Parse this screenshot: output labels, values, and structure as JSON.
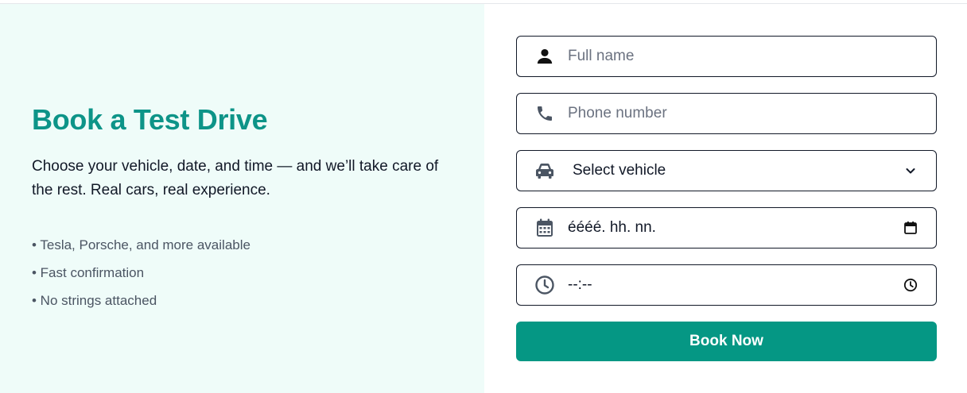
{
  "hero": {
    "title": "Book a Test Drive",
    "description": "Choose your vehicle, date, and time — and we’ll take care of the rest. Real cars, real experience.",
    "bullets": [
      "• Tesla, Porsche, and more available",
      "• Fast confirmation",
      "• No strings attached"
    ]
  },
  "form": {
    "name_placeholder": "Full name",
    "phone_placeholder": "Phone number",
    "vehicle_selected": "Select vehicle",
    "date_value": "éééé. hh. nn.",
    "time_value": "--:--",
    "submit_label": "Book Now"
  },
  "icons": {
    "name": "user-icon",
    "phone": "phone-icon",
    "vehicle": "car-icon",
    "date": "calendar-icon",
    "time": "clock-icon"
  },
  "colors": {
    "accent": "#0d9488",
    "button": "#059784",
    "left_panel_bg": "#effcf9"
  }
}
